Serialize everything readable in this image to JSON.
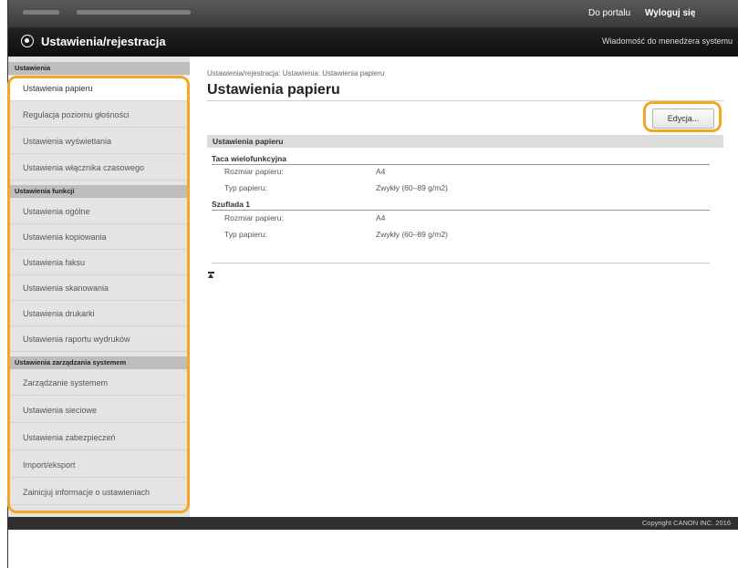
{
  "topbar": {
    "portal_link": "Do portalu",
    "logout_link": "Wyloguj się"
  },
  "header": {
    "title": "Ustawienia/rejestracja",
    "admin_message_link": "Wiadomość do menedżera systemu"
  },
  "sidebar": {
    "sections": [
      {
        "title": "Ustawienia",
        "items": [
          {
            "label": "Ustawienia papieru",
            "active": true
          },
          {
            "label": "Regulacja poziomu głośności"
          },
          {
            "label": "Ustawienia wyświetlania"
          },
          {
            "label": "Ustawienia włącznika czasowego"
          }
        ]
      },
      {
        "title": "Ustawienia funkcji",
        "items": [
          {
            "label": "Ustawienia ogólne"
          },
          {
            "label": "Ustawienia kopiowania"
          },
          {
            "label": "Ustawienia faksu"
          },
          {
            "label": "Ustawienia skanowania"
          },
          {
            "label": "Ustawienia drukarki"
          },
          {
            "label": "Ustawienia raportu wydruków"
          }
        ]
      },
      {
        "title": "Ustawienia zarządzania systemem",
        "items": [
          {
            "label": "Zarządzanie systemem"
          },
          {
            "label": "Ustawienia sieciowe"
          },
          {
            "label": "Ustawienia zabezpieczeń"
          },
          {
            "label": "Import/eksport"
          },
          {
            "label": "Zainicjuj informacje o ustawieniach"
          }
        ]
      }
    ]
  },
  "main": {
    "breadcrumb": "Ustawienia/rejestracja: Ustawienia: Ustawienia papieru",
    "page_title": "Ustawienia papieru",
    "edit_button": "Edycja...",
    "section_title": "Ustawienia papieru",
    "groups": [
      {
        "title": "Taca wielofunkcyjna",
        "rows": [
          {
            "label": "Rozmiar papieru:",
            "value": "A4"
          },
          {
            "label": "Typ papieru:",
            "value": "Zwykły (60–89 g/m2)"
          }
        ]
      },
      {
        "title": "Szuflada 1",
        "rows": [
          {
            "label": "Rozmiar papieru:",
            "value": "A4"
          },
          {
            "label": "Typ papieru:",
            "value": "Zwykły (60–89 g/m2)"
          }
        ]
      }
    ]
  },
  "footer": {
    "copyright": "Copyright CANON INC. 2016"
  },
  "colors": {
    "highlight": "#f5a623",
    "sidebar_bg": "#e4e4e4",
    "titlebar_bg": "#1a1a1a"
  }
}
